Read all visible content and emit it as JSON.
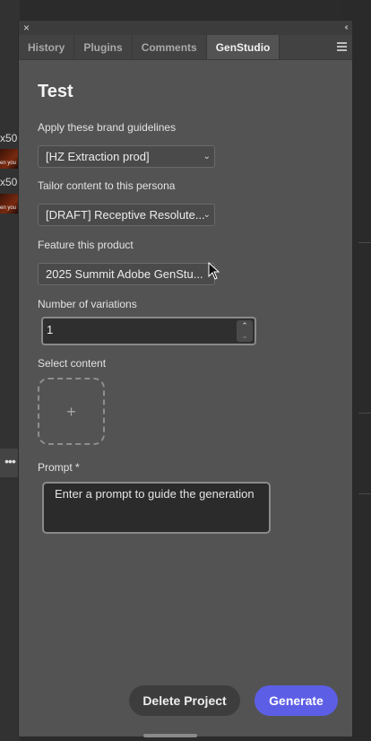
{
  "background": {
    "left_labels": [
      "x50",
      "x50"
    ],
    "thumb_captions": [
      "en you",
      "en you"
    ]
  },
  "panel": {
    "tabs": [
      {
        "label": "History"
      },
      {
        "label": "Plugins"
      },
      {
        "label": "Comments"
      },
      {
        "label": "GenStudio",
        "active": true
      }
    ],
    "title": "Test",
    "fields": {
      "brand_label": "Apply these brand guidelines",
      "brand_value": "[HZ Extraction prod]",
      "persona_label": "Tailor content to this persona",
      "persona_value": "[DRAFT] Receptive Resolute...",
      "product_label": "Feature this product",
      "product_value": "2025 Summit Adobe GenStu...",
      "variations_label": "Number of variations",
      "variations_value": "1",
      "content_label": "Select content",
      "prompt_label": "Prompt",
      "prompt_required": "*",
      "prompt_placeholder": "Enter a prompt to guide the generation"
    },
    "buttons": {
      "delete": "Delete Project",
      "generate": "Generate"
    }
  },
  "colors": {
    "panel_bg": "#535353",
    "accent": "#5d5ee6"
  },
  "icons": [
    "close-icon",
    "collapse-icon",
    "menu-icon",
    "chevron-down-icon",
    "stepper-up-icon",
    "stepper-down-icon",
    "plus-icon",
    "more-icon",
    "cursor-icon"
  ]
}
